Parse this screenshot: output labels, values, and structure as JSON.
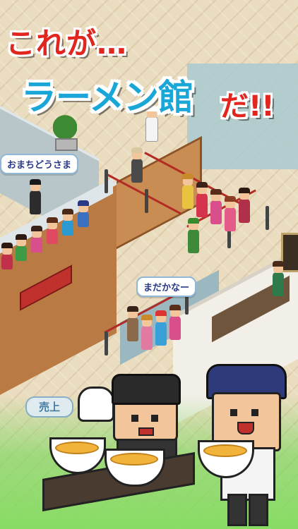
{
  "title": {
    "line1": "これが…",
    "line2": "ラーメン館",
    "line2_suffix": "だ!!"
  },
  "bubbles": {
    "left": "おまちどうさま",
    "middle": "まだかなー"
  },
  "sign": {
    "label": "売上"
  },
  "colors": {
    "title_red": "#e0261e",
    "title_blue": "#1aa7d8",
    "bubble_text": "#2a3a86",
    "bubble_border": "#8fb7d7",
    "floor": "#eadcbf",
    "counter_wood": "#c98c52",
    "rope_red": "#b22b25",
    "ramen_broth": "#f2b33a",
    "chef_hat": "#2f3a7a"
  }
}
